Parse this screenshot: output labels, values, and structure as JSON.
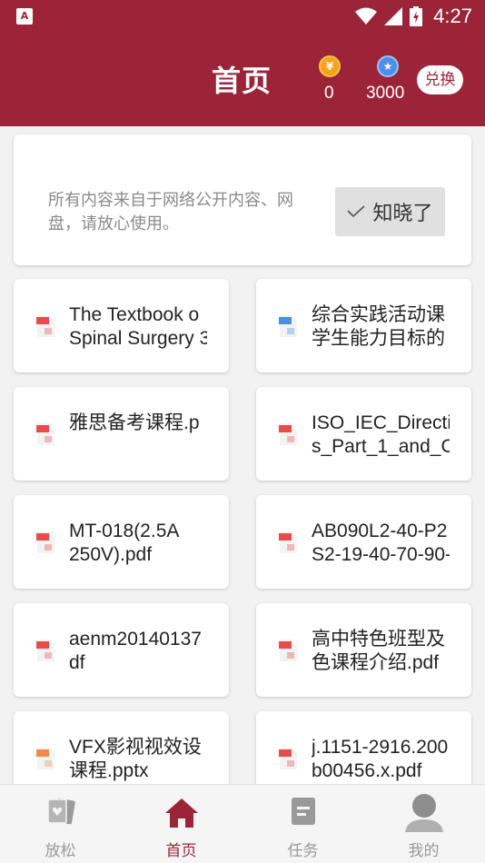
{
  "status_bar": {
    "time": "4:27",
    "app_badge": "A"
  },
  "header": {
    "title": "首页",
    "gold_coin": {
      "symbol": "¥",
      "value": "0"
    },
    "blue_coin": {
      "symbol": "★",
      "value": "3000"
    },
    "redeem_label": "兑换"
  },
  "notice": {
    "text": "所有内容来自于网络公开内容、网盘，请放心使用。",
    "ack_label": "知晓了"
  },
  "files": [
    {
      "lines": [
        "The Textbook o",
        "Spinal Surgery 3"
      ],
      "type": "pdf"
    },
    {
      "lines": [
        "综合实践活动课",
        "学生能力目标的"
      ],
      "type": "doc"
    },
    {
      "lines": [
        "雅思备考课程.p"
      ],
      "type": "pdf"
    },
    {
      "lines": [
        "ISO_IEC_Directi",
        "s_Part_1_and_C"
      ],
      "type": "pdf"
    },
    {
      "lines": [
        "MT-018(2.5A",
        "250V).pdf"
      ],
      "type": "pdf"
    },
    {
      "lines": [
        "AB090L2-40-P2",
        "S2-19-40-70-90-"
      ],
      "type": "pdf"
    },
    {
      "lines": [
        "aenm20140137",
        "df"
      ],
      "type": "pdf"
    },
    {
      "lines": [
        "高中特色班型及",
        "色课程介绍.pdf"
      ],
      "type": "pdf"
    },
    {
      "lines": [
        "VFX影视视效设",
        "课程.pptx"
      ],
      "type": "ppt"
    },
    {
      "lines": [
        "j.1151-2916.200",
        "b00456.x.pdf"
      ],
      "type": "pdf"
    }
  ],
  "tabs": [
    {
      "label": "放松",
      "icon": "cards-icon"
    },
    {
      "label": "首页",
      "icon": "home-icon"
    },
    {
      "label": "任务",
      "icon": "task-icon"
    },
    {
      "label": "我的",
      "icon": "profile-icon"
    }
  ],
  "colors": {
    "brand": "#9c2438",
    "pdf": "#e94b4b",
    "doc": "#4a90e2",
    "ppt": "#f08a4b"
  }
}
